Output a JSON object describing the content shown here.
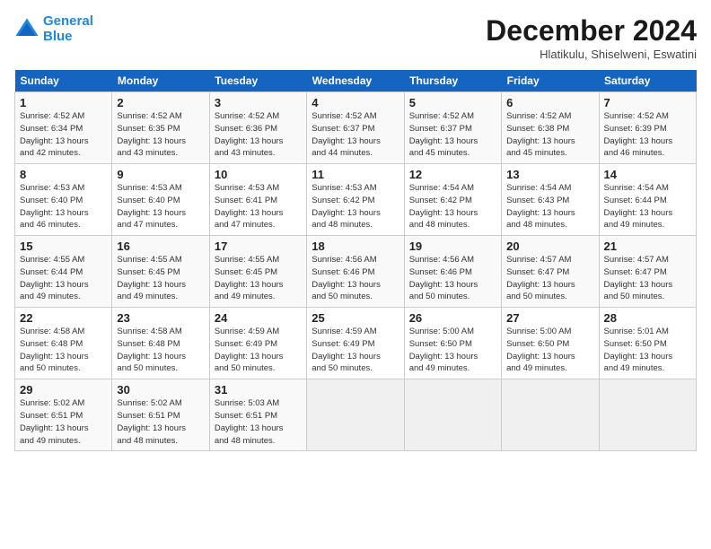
{
  "logo": {
    "line1": "General",
    "line2": "Blue"
  },
  "title": "December 2024",
  "subtitle": "Hlatikulu, Shiselweni, Eswatini",
  "days_of_week": [
    "Sunday",
    "Monday",
    "Tuesday",
    "Wednesday",
    "Thursday",
    "Friday",
    "Saturday"
  ],
  "weeks": [
    [
      {
        "day": 1,
        "info": "Sunrise: 4:52 AM\nSunset: 6:34 PM\nDaylight: 13 hours\nand 42 minutes."
      },
      {
        "day": 2,
        "info": "Sunrise: 4:52 AM\nSunset: 6:35 PM\nDaylight: 13 hours\nand 43 minutes."
      },
      {
        "day": 3,
        "info": "Sunrise: 4:52 AM\nSunset: 6:36 PM\nDaylight: 13 hours\nand 43 minutes."
      },
      {
        "day": 4,
        "info": "Sunrise: 4:52 AM\nSunset: 6:37 PM\nDaylight: 13 hours\nand 44 minutes."
      },
      {
        "day": 5,
        "info": "Sunrise: 4:52 AM\nSunset: 6:37 PM\nDaylight: 13 hours\nand 45 minutes."
      },
      {
        "day": 6,
        "info": "Sunrise: 4:52 AM\nSunset: 6:38 PM\nDaylight: 13 hours\nand 45 minutes."
      },
      {
        "day": 7,
        "info": "Sunrise: 4:52 AM\nSunset: 6:39 PM\nDaylight: 13 hours\nand 46 minutes."
      }
    ],
    [
      {
        "day": 8,
        "info": "Sunrise: 4:53 AM\nSunset: 6:40 PM\nDaylight: 13 hours\nand 46 minutes."
      },
      {
        "day": 9,
        "info": "Sunrise: 4:53 AM\nSunset: 6:40 PM\nDaylight: 13 hours\nand 47 minutes."
      },
      {
        "day": 10,
        "info": "Sunrise: 4:53 AM\nSunset: 6:41 PM\nDaylight: 13 hours\nand 47 minutes."
      },
      {
        "day": 11,
        "info": "Sunrise: 4:53 AM\nSunset: 6:42 PM\nDaylight: 13 hours\nand 48 minutes."
      },
      {
        "day": 12,
        "info": "Sunrise: 4:54 AM\nSunset: 6:42 PM\nDaylight: 13 hours\nand 48 minutes."
      },
      {
        "day": 13,
        "info": "Sunrise: 4:54 AM\nSunset: 6:43 PM\nDaylight: 13 hours\nand 48 minutes."
      },
      {
        "day": 14,
        "info": "Sunrise: 4:54 AM\nSunset: 6:44 PM\nDaylight: 13 hours\nand 49 minutes."
      }
    ],
    [
      {
        "day": 15,
        "info": "Sunrise: 4:55 AM\nSunset: 6:44 PM\nDaylight: 13 hours\nand 49 minutes."
      },
      {
        "day": 16,
        "info": "Sunrise: 4:55 AM\nSunset: 6:45 PM\nDaylight: 13 hours\nand 49 minutes."
      },
      {
        "day": 17,
        "info": "Sunrise: 4:55 AM\nSunset: 6:45 PM\nDaylight: 13 hours\nand 49 minutes."
      },
      {
        "day": 18,
        "info": "Sunrise: 4:56 AM\nSunset: 6:46 PM\nDaylight: 13 hours\nand 50 minutes."
      },
      {
        "day": 19,
        "info": "Sunrise: 4:56 AM\nSunset: 6:46 PM\nDaylight: 13 hours\nand 50 minutes."
      },
      {
        "day": 20,
        "info": "Sunrise: 4:57 AM\nSunset: 6:47 PM\nDaylight: 13 hours\nand 50 minutes."
      },
      {
        "day": 21,
        "info": "Sunrise: 4:57 AM\nSunset: 6:47 PM\nDaylight: 13 hours\nand 50 minutes."
      }
    ],
    [
      {
        "day": 22,
        "info": "Sunrise: 4:58 AM\nSunset: 6:48 PM\nDaylight: 13 hours\nand 50 minutes."
      },
      {
        "day": 23,
        "info": "Sunrise: 4:58 AM\nSunset: 6:48 PM\nDaylight: 13 hours\nand 50 minutes."
      },
      {
        "day": 24,
        "info": "Sunrise: 4:59 AM\nSunset: 6:49 PM\nDaylight: 13 hours\nand 50 minutes."
      },
      {
        "day": 25,
        "info": "Sunrise: 4:59 AM\nSunset: 6:49 PM\nDaylight: 13 hours\nand 50 minutes."
      },
      {
        "day": 26,
        "info": "Sunrise: 5:00 AM\nSunset: 6:50 PM\nDaylight: 13 hours\nand 49 minutes."
      },
      {
        "day": 27,
        "info": "Sunrise: 5:00 AM\nSunset: 6:50 PM\nDaylight: 13 hours\nand 49 minutes."
      },
      {
        "day": 28,
        "info": "Sunrise: 5:01 AM\nSunset: 6:50 PM\nDaylight: 13 hours\nand 49 minutes."
      }
    ],
    [
      {
        "day": 29,
        "info": "Sunrise: 5:02 AM\nSunset: 6:51 PM\nDaylight: 13 hours\nand 49 minutes."
      },
      {
        "day": 30,
        "info": "Sunrise: 5:02 AM\nSunset: 6:51 PM\nDaylight: 13 hours\nand 48 minutes."
      },
      {
        "day": 31,
        "info": "Sunrise: 5:03 AM\nSunset: 6:51 PM\nDaylight: 13 hours\nand 48 minutes."
      },
      null,
      null,
      null,
      null
    ]
  ]
}
